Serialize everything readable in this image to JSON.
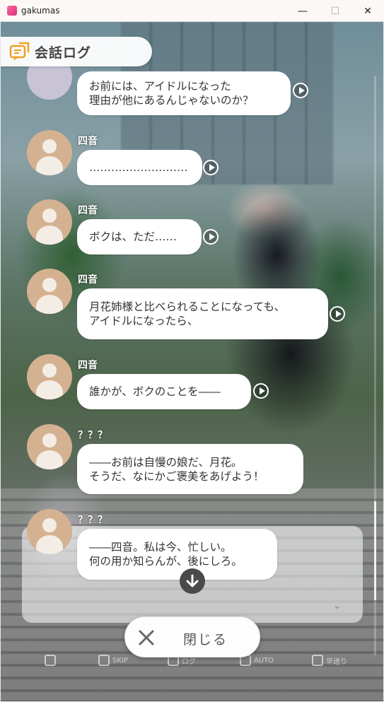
{
  "window": {
    "title": "gakumas",
    "minimize": "—",
    "maximize": "☐",
    "close": "✕"
  },
  "header": {
    "title": "会話ログ"
  },
  "messages": [
    {
      "speaker": "",
      "lines": [
        "お前には、アイドルになった",
        "理由が他にあるんじゃないのか？"
      ]
    },
    {
      "speaker": "四音",
      "lines": [
        "………………………"
      ]
    },
    {
      "speaker": "四音",
      "lines": [
        "ボクは、ただ……"
      ]
    },
    {
      "speaker": "四音",
      "lines": [
        "月花姉様と比べられることになっても、",
        "アイドルになったら、"
      ]
    },
    {
      "speaker": "四音",
      "lines": [
        "誰かが、ボクのことを――"
      ]
    },
    {
      "speaker": "？？？",
      "lines": [
        "――お前は自慢の娘だ、月花。",
        "そうだ、なにかご褒美をあげよう！"
      ]
    },
    {
      "speaker": "？？？",
      "lines": [
        "――四音。私は今、忙しい。",
        "何の用か知らんが、後にしろ。"
      ]
    }
  ],
  "controls": {
    "skip": "SKIP",
    "log": "ログ",
    "auto": "AUTO",
    "fast": "早送り"
  },
  "close_button": {
    "label": "閉じる"
  }
}
